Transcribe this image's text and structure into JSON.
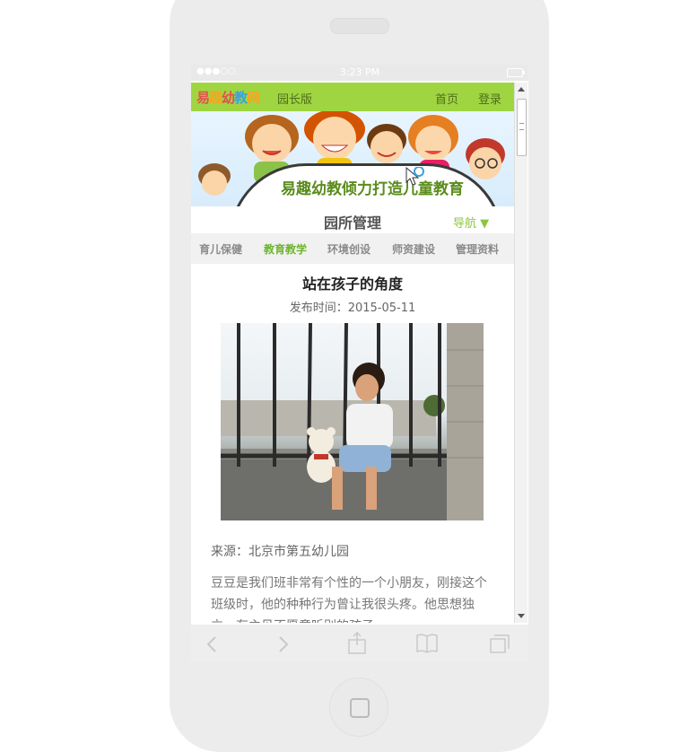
{
  "status_bar": {
    "signal": "●●●○○",
    "time": "3:23 PM"
  },
  "header": {
    "logo_text": [
      "易",
      "趣",
      "幼",
      "教",
      "网"
    ],
    "logo_colors": [
      "#e84e4e",
      "#f5a623",
      "#e84e4e",
      "#3aa1e0",
      "#f5a623"
    ],
    "subtitle": "园长版",
    "home_link": "首页",
    "login_link": "登录"
  },
  "banner": {
    "slogan": "易趣幼教倾力打造儿童教育"
  },
  "section": {
    "title": "园所管理",
    "nav_label": "导航 ▼"
  },
  "tabs": [
    {
      "label": "育儿保健",
      "active": false
    },
    {
      "label": "教育教学",
      "active": true
    },
    {
      "label": "环境创设",
      "active": false
    },
    {
      "label": "师资建设",
      "active": false
    },
    {
      "label": "管理资料",
      "active": false
    }
  ],
  "article": {
    "title": "站在孩子的角度",
    "date": "发布时间：2015-05-11",
    "source": "来源：北京市第五幼儿园",
    "paragraph": "豆豆是我们班非常有个性的一个小朋友，刚接这个班级时，他的种种行为曾让我很头疼。他思想独立，有主见不愿意听别的孩子"
  },
  "toolbar": {
    "icons": [
      "back-icon",
      "forward-icon",
      "share-icon",
      "bookmarks-icon",
      "tabs-icon"
    ]
  },
  "colors": {
    "brand_green": "#9fd541",
    "active_tab": "#6cb52c"
  }
}
